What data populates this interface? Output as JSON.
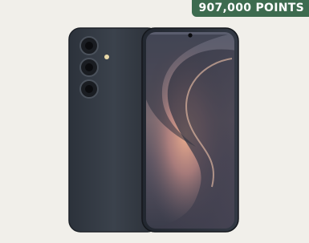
{
  "badge": {
    "points_text": "907,000 POINTS"
  },
  "product": {
    "image_icon": "smartphone-icon"
  },
  "colors": {
    "badge_bg": "#3d6b4f",
    "background": "#f1efea"
  }
}
